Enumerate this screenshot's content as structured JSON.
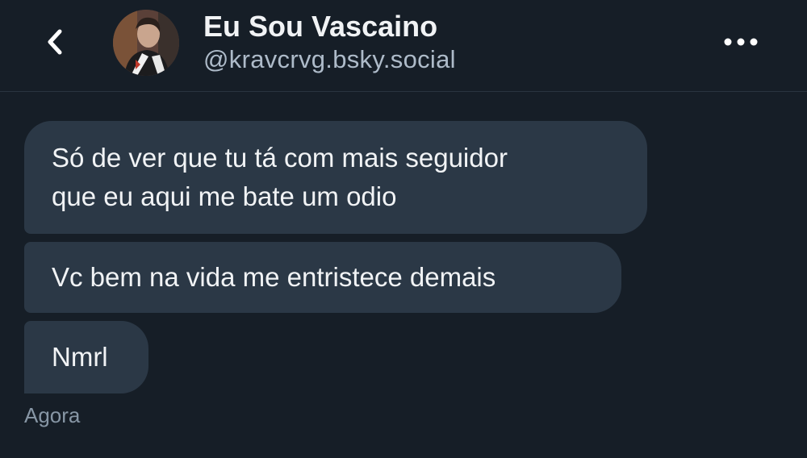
{
  "header": {
    "display_name": "Eu Sou Vascaino",
    "handle": "@kravcrvg.bsky.social",
    "back_icon": "chevron-left-icon",
    "more_icon": "more-horizontal-icon"
  },
  "messages": [
    {
      "lines": [
        "Só de ver que tu tá com mais seguidor",
        "que eu aqui me bate um odio"
      ]
    },
    {
      "lines": [
        "Vc bem na vida me entristece demais"
      ]
    },
    {
      "lines": [
        "Nmrl"
      ]
    }
  ],
  "timestamp": "Agora",
  "colors": {
    "background": "#161e27",
    "bubble": "#2b3846",
    "text": "#f1f3f5",
    "secondary_text": "#aebbc9"
  }
}
